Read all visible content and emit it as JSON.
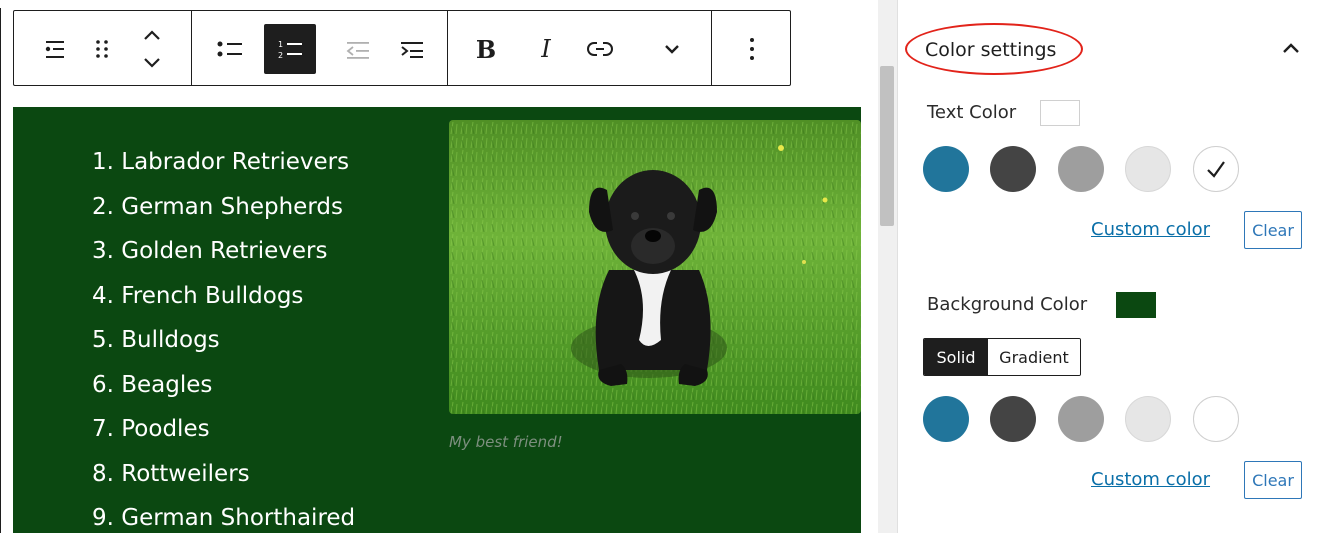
{
  "toolbar": {
    "buttons": [
      {
        "name": "list-block-icon"
      },
      {
        "name": "drag-handle-icon"
      },
      {
        "name": "move-up-down-icon"
      },
      {
        "name": "unordered-list-icon"
      },
      {
        "name": "ordered-list-icon",
        "active": true
      },
      {
        "name": "outdent-icon",
        "disabled": true
      },
      {
        "name": "indent-icon"
      },
      {
        "name": "bold-icon",
        "label": "B"
      },
      {
        "name": "italic-icon",
        "label": "I"
      },
      {
        "name": "link-icon"
      },
      {
        "name": "more-formatting-chevron-icon"
      },
      {
        "name": "more-options-icon"
      }
    ]
  },
  "content": {
    "background": "#0b4811",
    "list_items": [
      "1. Labrador Retrievers",
      "2. German Shepherds",
      "3. Golden Retrievers",
      "4. French Bulldogs",
      "5. Bulldogs",
      "6. Beagles",
      "7. Poodles",
      "8. Rottweilers",
      "9. German Shorthaired"
    ],
    "image": {
      "subject": "black puppy sitting in grass"
    },
    "caption": "My best friend!"
  },
  "panel": {
    "title": "Color settings",
    "text_color": {
      "label": "Text Color",
      "current": "#ffffff",
      "swatches": [
        "#21759b",
        "#444444",
        "#9e9e9e",
        "#e6e6e6",
        "#ffffff"
      ],
      "selected_index": 4,
      "custom_label": "Custom color",
      "clear_label": "Clear"
    },
    "background_color": {
      "label": "Background Color",
      "current": "#0b4811",
      "tabs": [
        "Solid",
        "Gradient"
      ],
      "active_tab": "Solid",
      "swatches": [
        "#21759b",
        "#444444",
        "#9e9e9e",
        "#e6e6e6",
        "#ffffff"
      ],
      "custom_label": "Custom color",
      "clear_label": "Clear"
    }
  },
  "colors": {
    "highlight_oval": "#e2231a",
    "link": "#0a6fa8"
  }
}
